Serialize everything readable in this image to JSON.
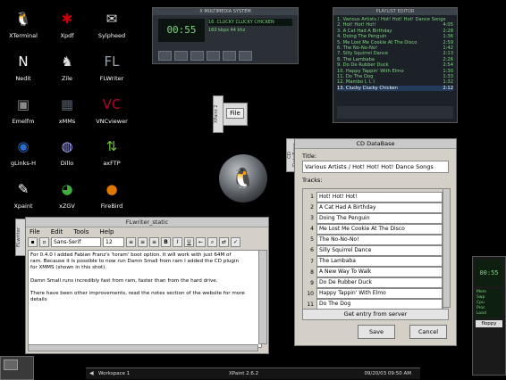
{
  "desktop_icons": [
    {
      "label": "XTerminal",
      "icon": "penguin-icon",
      "glyph": "🐧",
      "color": "#f0f0f0"
    },
    {
      "label": "Xpdf",
      "icon": "pdf-icon",
      "glyph": "✱",
      "color": "#cc0000"
    },
    {
      "label": "Sylpheed",
      "icon": "mail-icon",
      "glyph": "✉",
      "color": "#e0e0e0"
    },
    {
      "label": "Nedit",
      "icon": "nedit-icon",
      "glyph": "N",
      "color": "#ffffff"
    },
    {
      "label": "Zile",
      "icon": "gnu-icon",
      "glyph": "♞",
      "color": "#dddddd"
    },
    {
      "label": "FLWriter",
      "icon": "flwriter-icon",
      "glyph": "FL",
      "color": "#9aa4b0"
    },
    {
      "label": "Emelfm",
      "icon": "filemanager-icon",
      "glyph": "▣",
      "color": "#8a8a8a"
    },
    {
      "label": "xMMs",
      "icon": "xmms-icon",
      "glyph": "▦",
      "color": "#555c66"
    },
    {
      "label": "VNCviewer",
      "icon": "vnc-icon",
      "glyph": "VC",
      "color": "#b0002b"
    },
    {
      "label": "gLinks-H",
      "icon": "globe-icon",
      "glyph": "◉",
      "color": "#2a6fd0"
    },
    {
      "label": "Dillo",
      "icon": "dillo-icon",
      "glyph": "◍",
      "color": "#a9a9ff"
    },
    {
      "label": "axFTP",
      "icon": "ftp-icon",
      "glyph": "⇅",
      "color": "#6fbf3f"
    },
    {
      "label": "Xpaint",
      "icon": "xpaint-icon",
      "glyph": "✎",
      "color": "#ffffff"
    },
    {
      "label": "xZGV",
      "icon": "image-viewer-icon",
      "glyph": "◕",
      "color": "#3fae3f"
    },
    {
      "label": "FireBird",
      "icon": "firebird-icon",
      "glyph": "●",
      "color": "#e07800"
    }
  ],
  "xmms": {
    "title": "X MULTIMEDIA SYSTEM",
    "time": "00:55",
    "track_title": "16. CLUCKY CLUCKY CHICKEN",
    "bitrate": "160 kbps",
    "samplerate": "44 khz"
  },
  "playlist": {
    "title": "PLAYLIST EDITOR",
    "items": [
      {
        "label": "1. Various Artists / Hot! Hot! Hot! Dance Songs",
        "time": ""
      },
      {
        "label": "2. Hot! Hot! Hot!",
        "time": "4:05"
      },
      {
        "label": "3. A Cat Had A Birthday",
        "time": "2:28"
      },
      {
        "label": "4. Doing The Penguin",
        "time": "1:36"
      },
      {
        "label": "5. Me Lost Me Cookie At The Disco",
        "time": "2:59"
      },
      {
        "label": "6. The No-No-No!",
        "time": "1:42"
      },
      {
        "label": "7. Silly Squirrel Dance",
        "time": "2:13"
      },
      {
        "label": "8. The Lambaba",
        "time": "2:26"
      },
      {
        "label": "9. Do De Rubber Duck",
        "time": "2:54"
      },
      {
        "label": "10. Happy Tappin' With Elmo",
        "time": "1:30"
      },
      {
        "label": "11. Do The Dog",
        "time": "1:33"
      },
      {
        "label": "12. Mambo I, I, I",
        "time": "1:32"
      },
      {
        "label": "13. Clucky Clucky Chicken",
        "time": "2:12"
      }
    ],
    "selected_index": 12
  },
  "xpaint_toolbox": {
    "tab": "XPaint 2",
    "file_label": "File"
  },
  "editor": {
    "title": "FLwriter_static",
    "side_tab": "FLwriter",
    "menu": [
      "File",
      "Edit",
      "Tools",
      "Help"
    ],
    "font": "Sans-Serif",
    "size": "12",
    "text_lines": [
      "For 0.4.0 I added Fabian Franz's 'toram' boot option.  It will work with just 64M of",
      "ram.  Because it is possible to now run Damn Small from ram I added the CD plugin",
      "for XMMS (shown in this shot).",
      "",
      "Damn Small runs incredibly fast from ram, faster than from the hard drive.",
      "",
      "There have been other improvements, read the notes section of the website for more",
      "details"
    ]
  },
  "cddb": {
    "title": "CD DataBase",
    "side_tab": "CD DataBase",
    "title_label": "Title:",
    "title_value": "Various Artists / Hot! Hot! Hot! Dance Songs",
    "tracks_label": "Tracks:",
    "tracks": [
      {
        "n": "1",
        "t": "Hot! Hot! Hot!"
      },
      {
        "n": "2",
        "t": "A Cat Had A Birthday"
      },
      {
        "n": "3",
        "t": "Doing The Penguin"
      },
      {
        "n": "4",
        "t": "Me Lost Me Cookie At The Disco"
      },
      {
        "n": "5",
        "t": "The No-No-No!"
      },
      {
        "n": "6",
        "t": "Silly Squirrel Dance"
      },
      {
        "n": "7",
        "t": "The Lambaba"
      },
      {
        "n": "8",
        "t": "A New Way To Walk"
      },
      {
        "n": "9",
        "t": "Do De Rubber Duck"
      },
      {
        "n": "10",
        "t": "Happy Tappin' With Elmo"
      },
      {
        "n": "11",
        "t": "Do The Dog"
      }
    ],
    "get_entry": "Get entry from server",
    "save": "Save",
    "cancel": "Cancel"
  },
  "dock": {
    "readout": "00:55",
    "stats": [
      "Mem",
      "Swp",
      "Cpu",
      "Proc",
      "Load"
    ],
    "name": "floppy"
  },
  "taskbar": {
    "workspace": "Workspace 1",
    "task": "XPaint 2.6.2",
    "clock": "09/20/03 09:50 AM"
  }
}
